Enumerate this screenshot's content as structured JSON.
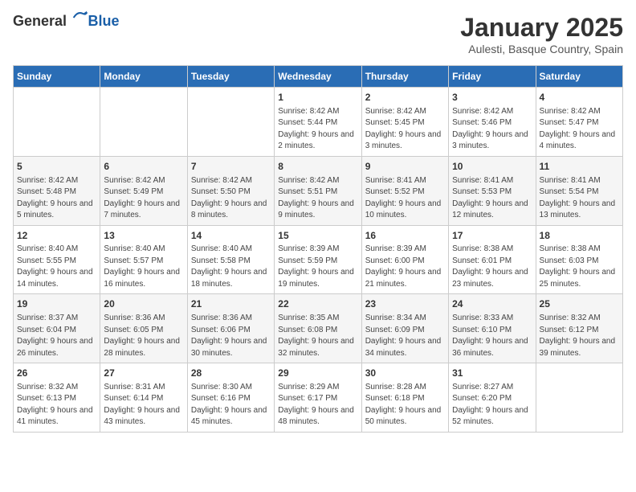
{
  "header": {
    "logo_general": "General",
    "logo_blue": "Blue",
    "month_title": "January 2025",
    "location": "Aulesti, Basque Country, Spain"
  },
  "days_of_week": [
    "Sunday",
    "Monday",
    "Tuesday",
    "Wednesday",
    "Thursday",
    "Friday",
    "Saturday"
  ],
  "weeks": [
    [
      {
        "day": "",
        "content": ""
      },
      {
        "day": "",
        "content": ""
      },
      {
        "day": "",
        "content": ""
      },
      {
        "day": "1",
        "content": "Sunrise: 8:42 AM\nSunset: 5:44 PM\nDaylight: 9 hours\nand 2 minutes."
      },
      {
        "day": "2",
        "content": "Sunrise: 8:42 AM\nSunset: 5:45 PM\nDaylight: 9 hours\nand 3 minutes."
      },
      {
        "day": "3",
        "content": "Sunrise: 8:42 AM\nSunset: 5:46 PM\nDaylight: 9 hours\nand 3 minutes."
      },
      {
        "day": "4",
        "content": "Sunrise: 8:42 AM\nSunset: 5:47 PM\nDaylight: 9 hours\nand 4 minutes."
      }
    ],
    [
      {
        "day": "5",
        "content": "Sunrise: 8:42 AM\nSunset: 5:48 PM\nDaylight: 9 hours\nand 5 minutes."
      },
      {
        "day": "6",
        "content": "Sunrise: 8:42 AM\nSunset: 5:49 PM\nDaylight: 9 hours\nand 7 minutes."
      },
      {
        "day": "7",
        "content": "Sunrise: 8:42 AM\nSunset: 5:50 PM\nDaylight: 9 hours\nand 8 minutes."
      },
      {
        "day": "8",
        "content": "Sunrise: 8:42 AM\nSunset: 5:51 PM\nDaylight: 9 hours\nand 9 minutes."
      },
      {
        "day": "9",
        "content": "Sunrise: 8:41 AM\nSunset: 5:52 PM\nDaylight: 9 hours\nand 10 minutes."
      },
      {
        "day": "10",
        "content": "Sunrise: 8:41 AM\nSunset: 5:53 PM\nDaylight: 9 hours\nand 12 minutes."
      },
      {
        "day": "11",
        "content": "Sunrise: 8:41 AM\nSunset: 5:54 PM\nDaylight: 9 hours\nand 13 minutes."
      }
    ],
    [
      {
        "day": "12",
        "content": "Sunrise: 8:40 AM\nSunset: 5:55 PM\nDaylight: 9 hours\nand 14 minutes."
      },
      {
        "day": "13",
        "content": "Sunrise: 8:40 AM\nSunset: 5:57 PM\nDaylight: 9 hours\nand 16 minutes."
      },
      {
        "day": "14",
        "content": "Sunrise: 8:40 AM\nSunset: 5:58 PM\nDaylight: 9 hours\nand 18 minutes."
      },
      {
        "day": "15",
        "content": "Sunrise: 8:39 AM\nSunset: 5:59 PM\nDaylight: 9 hours\nand 19 minutes."
      },
      {
        "day": "16",
        "content": "Sunrise: 8:39 AM\nSunset: 6:00 PM\nDaylight: 9 hours\nand 21 minutes."
      },
      {
        "day": "17",
        "content": "Sunrise: 8:38 AM\nSunset: 6:01 PM\nDaylight: 9 hours\nand 23 minutes."
      },
      {
        "day": "18",
        "content": "Sunrise: 8:38 AM\nSunset: 6:03 PM\nDaylight: 9 hours\nand 25 minutes."
      }
    ],
    [
      {
        "day": "19",
        "content": "Sunrise: 8:37 AM\nSunset: 6:04 PM\nDaylight: 9 hours\nand 26 minutes."
      },
      {
        "day": "20",
        "content": "Sunrise: 8:36 AM\nSunset: 6:05 PM\nDaylight: 9 hours\nand 28 minutes."
      },
      {
        "day": "21",
        "content": "Sunrise: 8:36 AM\nSunset: 6:06 PM\nDaylight: 9 hours\nand 30 minutes."
      },
      {
        "day": "22",
        "content": "Sunrise: 8:35 AM\nSunset: 6:08 PM\nDaylight: 9 hours\nand 32 minutes."
      },
      {
        "day": "23",
        "content": "Sunrise: 8:34 AM\nSunset: 6:09 PM\nDaylight: 9 hours\nand 34 minutes."
      },
      {
        "day": "24",
        "content": "Sunrise: 8:33 AM\nSunset: 6:10 PM\nDaylight: 9 hours\nand 36 minutes."
      },
      {
        "day": "25",
        "content": "Sunrise: 8:32 AM\nSunset: 6:12 PM\nDaylight: 9 hours\nand 39 minutes."
      }
    ],
    [
      {
        "day": "26",
        "content": "Sunrise: 8:32 AM\nSunset: 6:13 PM\nDaylight: 9 hours\nand 41 minutes."
      },
      {
        "day": "27",
        "content": "Sunrise: 8:31 AM\nSunset: 6:14 PM\nDaylight: 9 hours\nand 43 minutes."
      },
      {
        "day": "28",
        "content": "Sunrise: 8:30 AM\nSunset: 6:16 PM\nDaylight: 9 hours\nand 45 minutes."
      },
      {
        "day": "29",
        "content": "Sunrise: 8:29 AM\nSunset: 6:17 PM\nDaylight: 9 hours\nand 48 minutes."
      },
      {
        "day": "30",
        "content": "Sunrise: 8:28 AM\nSunset: 6:18 PM\nDaylight: 9 hours\nand 50 minutes."
      },
      {
        "day": "31",
        "content": "Sunrise: 8:27 AM\nSunset: 6:20 PM\nDaylight: 9 hours\nand 52 minutes."
      },
      {
        "day": "",
        "content": ""
      }
    ]
  ]
}
